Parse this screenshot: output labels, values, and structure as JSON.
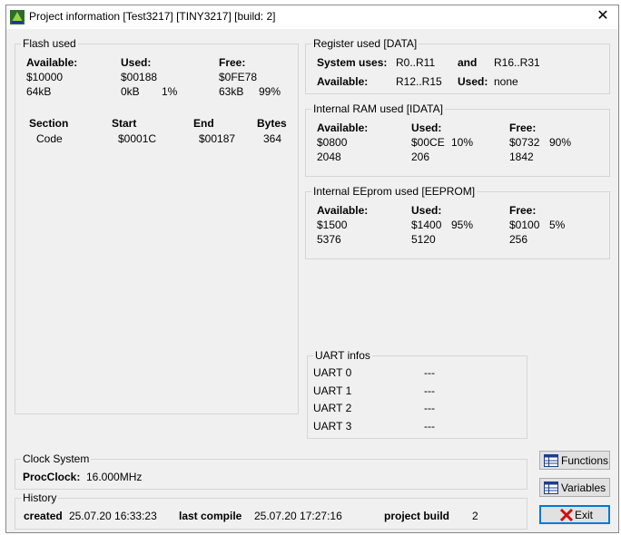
{
  "window": {
    "title": "Project information [Test3217] [TINY3217] [build: 2]"
  },
  "flash": {
    "legend": "Flash used",
    "available_label": "Available:",
    "used_label": "Used:",
    "free_label": "Free:",
    "available_hex": "$10000",
    "used_hex": "$00188",
    "free_hex": "$0FE78",
    "available_kb": "64kB",
    "used_kb": "0kB",
    "used_pct": "1%",
    "free_kb": "63kB",
    "free_pct": "99%",
    "columns": [
      "Section",
      "Start",
      "End",
      "Bytes"
    ],
    "rows": [
      {
        "section": "Code",
        "start": "$0001C",
        "end": "$00187",
        "bytes": "364"
      }
    ]
  },
  "registers": {
    "legend": "Register used [DATA]",
    "system_uses_label": "System uses:",
    "system_uses_1": "R0..R11",
    "and_label": "and",
    "system_uses_2": "R16..R31",
    "available_label": "Available:",
    "available_value": "R12..R15",
    "used_label": "Used:",
    "used_value": "none"
  },
  "ram": {
    "legend": "Internal RAM used [IDATA]",
    "available_label": "Available:",
    "used_label": "Used:",
    "free_label": "Free:",
    "available_hex": "$0800",
    "used_hex": "$00CE",
    "used_pct": "10%",
    "free_hex": "$0732",
    "free_pct": "90%",
    "available_dec": "2048",
    "used_dec": "206",
    "free_dec": "1842"
  },
  "eeprom": {
    "legend": "Internal EEprom used [EEPROM]",
    "available_label": "Available:",
    "used_label": "Used:",
    "free_label": "Free:",
    "available_hex": "$1500",
    "used_hex": "$1400",
    "used_pct": "95%",
    "free_hex": "$0100",
    "free_pct": "5%",
    "available_dec": "5376",
    "used_dec": "5120",
    "free_dec": "256"
  },
  "uart": {
    "legend": "UART infos",
    "items": [
      {
        "name": "UART 0",
        "value": "---"
      },
      {
        "name": "UART 1",
        "value": "---"
      },
      {
        "name": "UART 2",
        "value": "---"
      },
      {
        "name": "UART 3",
        "value": "---"
      }
    ]
  },
  "clock": {
    "legend": "Clock System",
    "label": "ProcClock:",
    "value": "16.000MHz"
  },
  "history": {
    "legend": "History",
    "created_label": "created",
    "created_value": "25.07.20 16:33:23",
    "last_compile_label": "last compile",
    "last_compile_value": "25.07.20 17:27:16",
    "build_label": "project build",
    "build_value": "2"
  },
  "buttons": {
    "functions": "Functions",
    "variables": "Variables",
    "exit": "Exit"
  },
  "icons": {
    "app": "bascom-app-icon",
    "close": "close-icon",
    "functions": "table-icon",
    "variables": "table-icon",
    "exit": "red-x-icon"
  },
  "colors": {
    "exit_x": "#cc1111",
    "focus_border": "#0078d7",
    "background_text": "#1f3f8f"
  }
}
